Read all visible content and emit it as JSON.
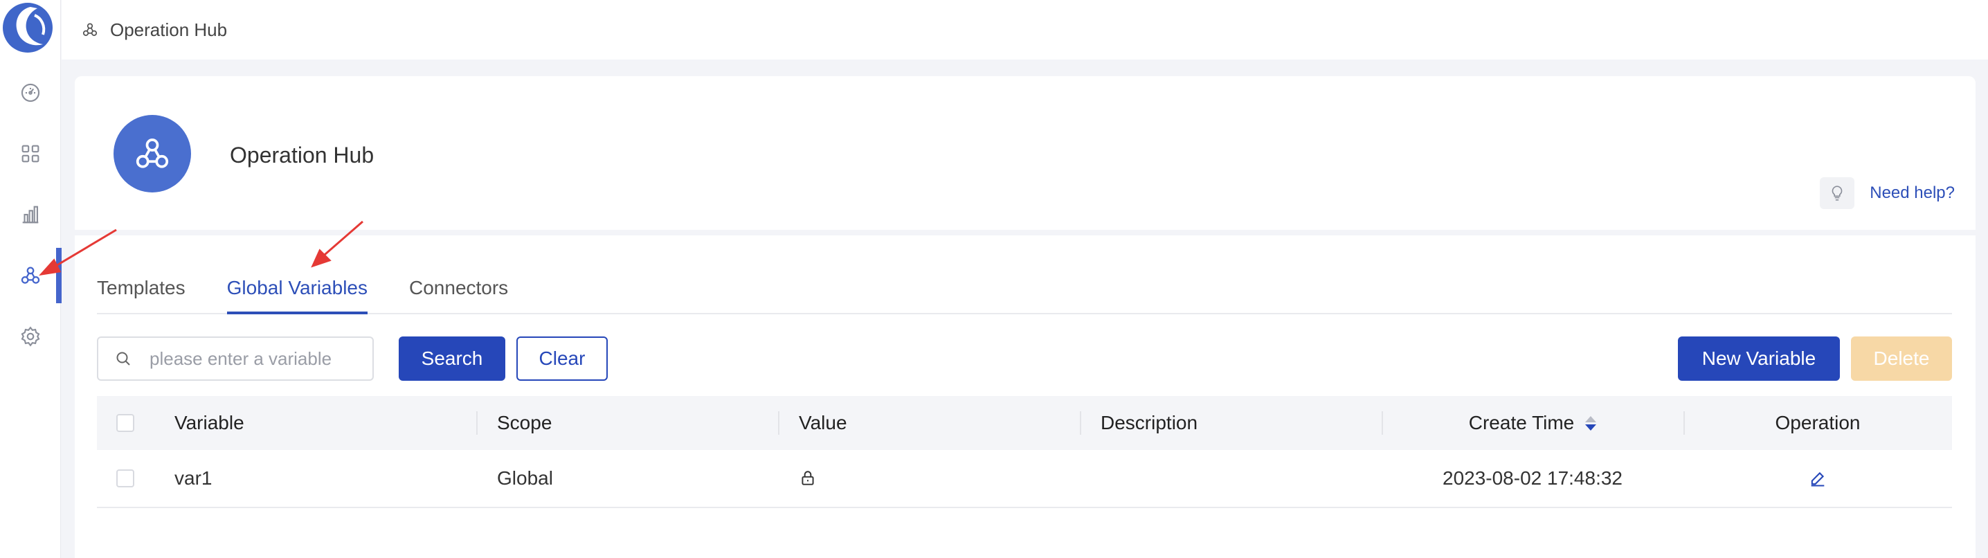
{
  "topbar": {
    "title": "Operation Hub",
    "icon": "operation-hub-icon"
  },
  "rail": {
    "items": [
      {
        "name": "dashboard-icon",
        "active": false
      },
      {
        "name": "apps-grid-icon",
        "active": false
      },
      {
        "name": "analytics-icon",
        "active": false
      },
      {
        "name": "operation-hub-icon",
        "active": true
      },
      {
        "name": "settings-icon",
        "active": false
      }
    ]
  },
  "header": {
    "title": "Operation Hub",
    "help_label": "Need help?"
  },
  "tabs": [
    {
      "label": "Templates",
      "active": false
    },
    {
      "label": "Global Variables",
      "active": true
    },
    {
      "label": "Connectors",
      "active": false
    }
  ],
  "toolbar": {
    "search_placeholder": "please enter a variable",
    "search_label": "Search",
    "clear_label": "Clear",
    "new_label": "New Variable",
    "delete_label": "Delete"
  },
  "table": {
    "columns": [
      "Variable",
      "Scope",
      "Value",
      "Description",
      "Create Time",
      "Operation"
    ],
    "rows": [
      {
        "variable": "var1",
        "scope": "Global",
        "value_icon": "lock-icon",
        "description": "",
        "create_time": "2023-08-02 17:48:32",
        "operation_icon": "edit-icon"
      }
    ]
  },
  "colors": {
    "accent": "#2647b9",
    "delete_disabled": "#f7d8a6",
    "annotation": "#e53935"
  }
}
